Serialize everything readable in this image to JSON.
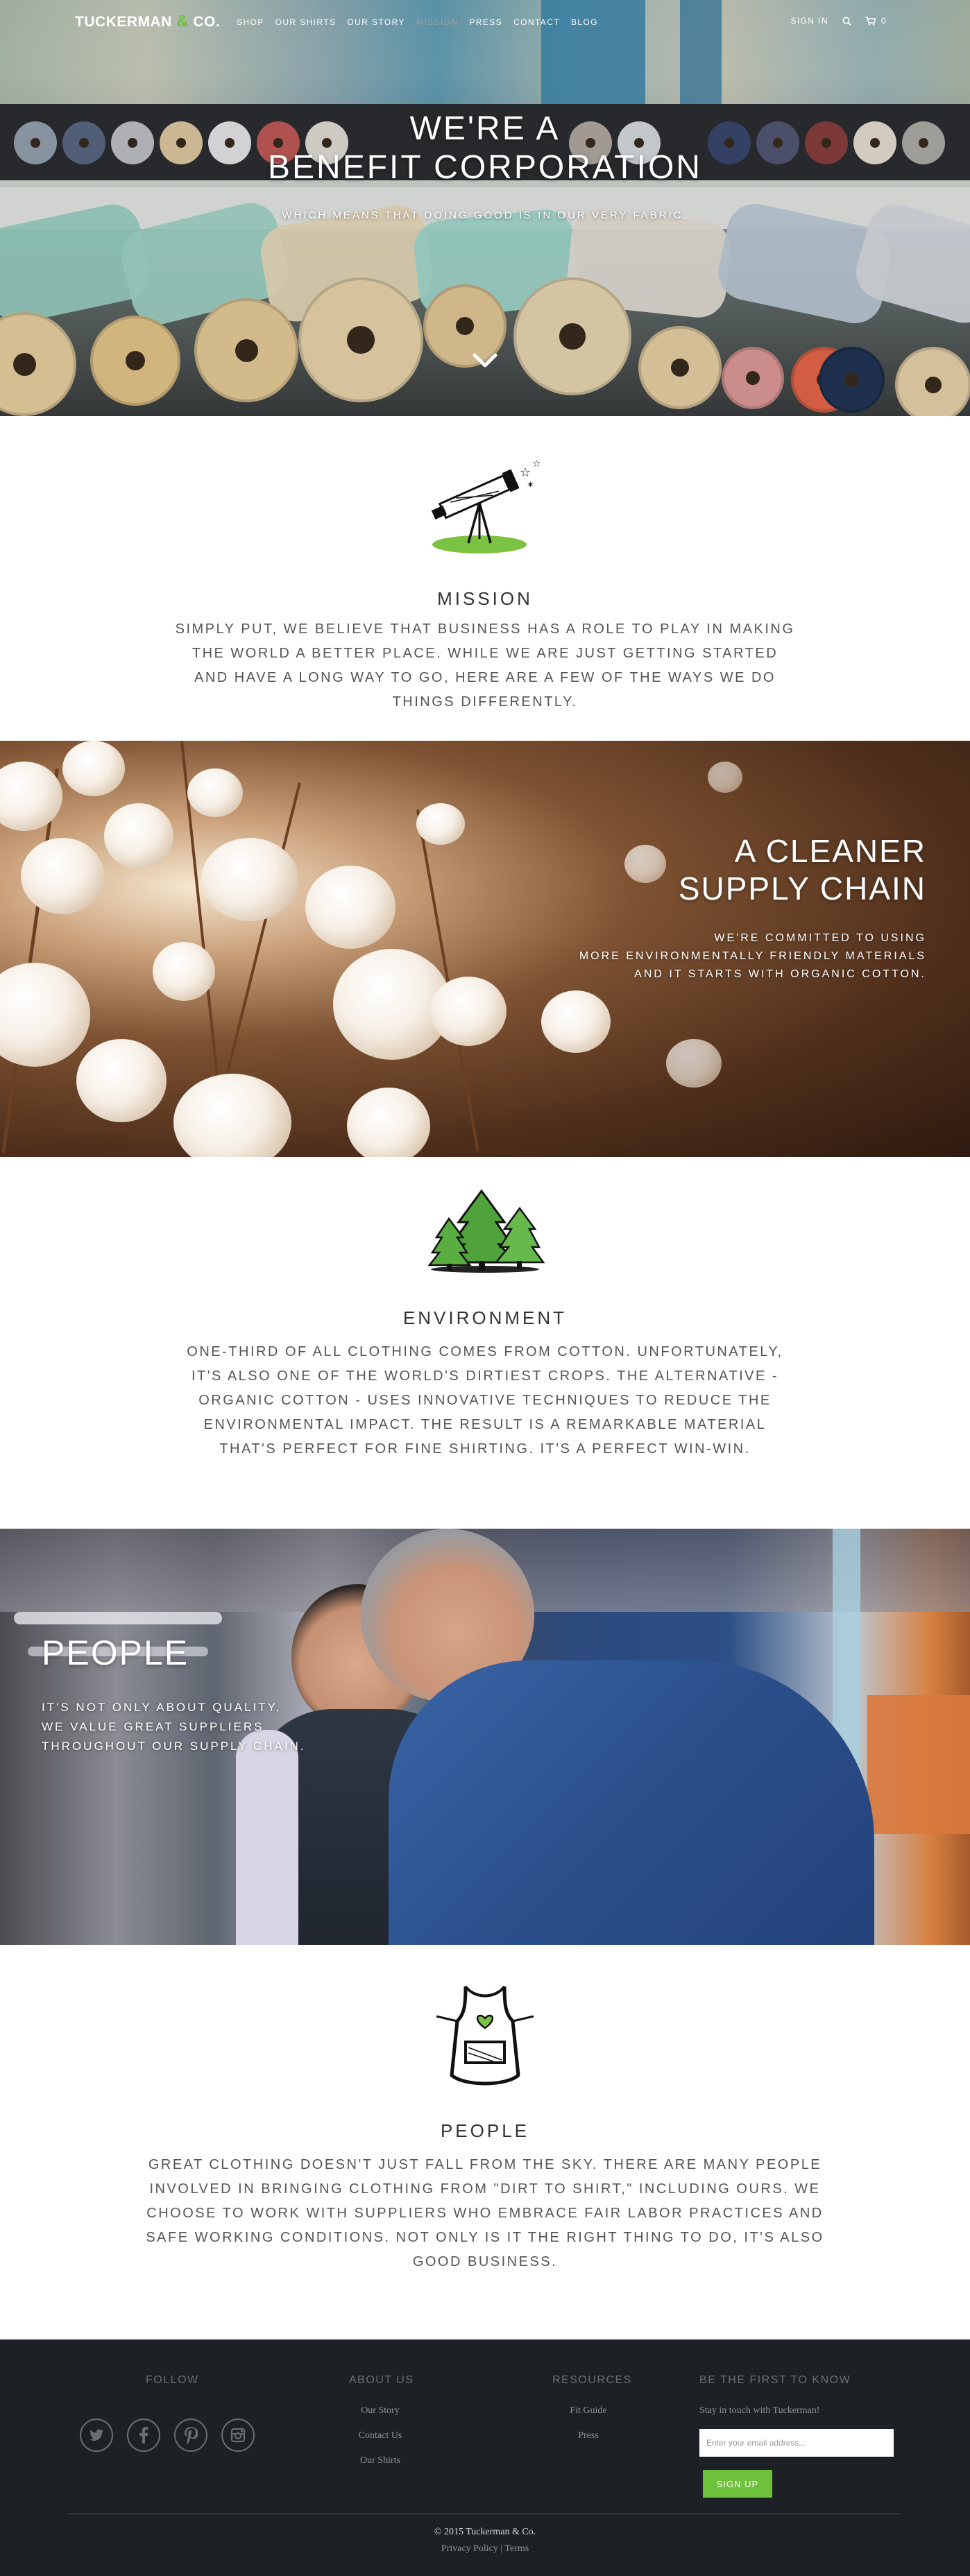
{
  "nav": {
    "brand_name": "TUCKERMAN",
    "brand_amp": "&",
    "brand_suffix": "CO.",
    "links": [
      "SHOP",
      "OUR SHIRTS",
      "OUR STORY",
      "MISSION",
      "PRESS",
      "CONTACT",
      "BLOG"
    ],
    "active_link": "MISSION",
    "sign_in": "SIGN IN",
    "cart_count": "0",
    "icons": [
      "search-icon",
      "cart-icon"
    ]
  },
  "hero": {
    "title_line1": "WE'RE A",
    "title_line2": "BENEFIT CORPORATION",
    "subtitle": "WHICH MEANS THAT DOING GOOD IS IN OUR VERY FABRIC.",
    "scroll_icon": "chevron-down-icon"
  },
  "mission": {
    "icon": "telescope-icon",
    "title": "MISSION",
    "text": "SIMPLY PUT, WE BELIEVE THAT BUSINESS HAS A ROLE TO PLAY IN MAKING THE WORLD A BETTER PLACE. WHILE WE ARE JUST GETTING STARTED AND HAVE A LONG WAY TO GO, HERE ARE A FEW OF THE WAYS WE DO THINGS DIFFERENTLY."
  },
  "supply_chain": {
    "title_line1": "A CLEANER",
    "title_line2": "SUPPLY CHAIN",
    "sub_line1": "WE'RE COMMITTED TO USING",
    "sub_line2": "MORE ENVIRONMENTALLY FRIENDLY MATERIALS",
    "sub_line3": "AND IT STARTS WITH ORGANIC COTTON."
  },
  "environment": {
    "icon": "trees-icon",
    "title": "ENVIRONMENT",
    "text": "ONE-THIRD OF ALL CLOTHING COMES FROM COTTON. UNFORTUNATELY, IT'S ALSO ONE OF THE WORLD'S DIRTIEST CROPS. THE ALTERNATIVE - ORGANIC COTTON - USES INNOVATIVE TECHNIQUES TO REDUCE THE ENVIRONMENTAL IMPACT. THE RESULT IS A REMARKABLE MATERIAL THAT'S PERFECT FOR FINE SHIRTING. IT'S A PERFECT WIN-WIN."
  },
  "people_band": {
    "title": "PEOPLE",
    "sub_line1": "IT'S NOT ONLY ABOUT QUALITY,",
    "sub_line2": "WE VALUE GREAT SUPPLIERS",
    "sub_line3": "THROUGHOUT OUR SUPPLY CHAIN."
  },
  "people": {
    "icon": "apron-icon",
    "title": "PEOPLE",
    "text": "GREAT CLOTHING DOESN'T JUST FALL FROM THE SKY. THERE ARE MANY PEOPLE INVOLVED IN BRINGING CLOTHING FROM \"DIRT TO SHIRT,\" INCLUDING OURS. WE CHOOSE TO WORK WITH SUPPLIERS WHO EMBRACE FAIR LABOR PRACTICES AND SAFE WORKING CONDITIONS. NOT ONLY IS IT THE RIGHT THING TO DO, IT'S ALSO GOOD BUSINESS."
  },
  "footer": {
    "follow_title": "FOLLOW",
    "social_icons": [
      "twitter-icon",
      "facebook-icon",
      "pinterest-icon",
      "instagram-icon"
    ],
    "about_title": "ABOUT US",
    "about_links": [
      "Our Story",
      "Contact Us",
      "Our Shirts"
    ],
    "resources_title": "RESOURCES",
    "resources_links": [
      "Fit Guide",
      "Press"
    ],
    "signup_title": "BE THE FIRST TO KNOW",
    "signup_tagline": "Stay in touch with Tuckerman!",
    "email_placeholder": "Enter your email address...",
    "signup_button": "SIGN UP",
    "copyright": "© 2015 Tuckerman & Co.",
    "privacy": "Privacy Policy",
    "separator": "|",
    "terms": "Terms"
  },
  "colors": {
    "brand_green": "#6dc13b",
    "footer_bg": "#1d2024",
    "text_gray": "#555555"
  }
}
